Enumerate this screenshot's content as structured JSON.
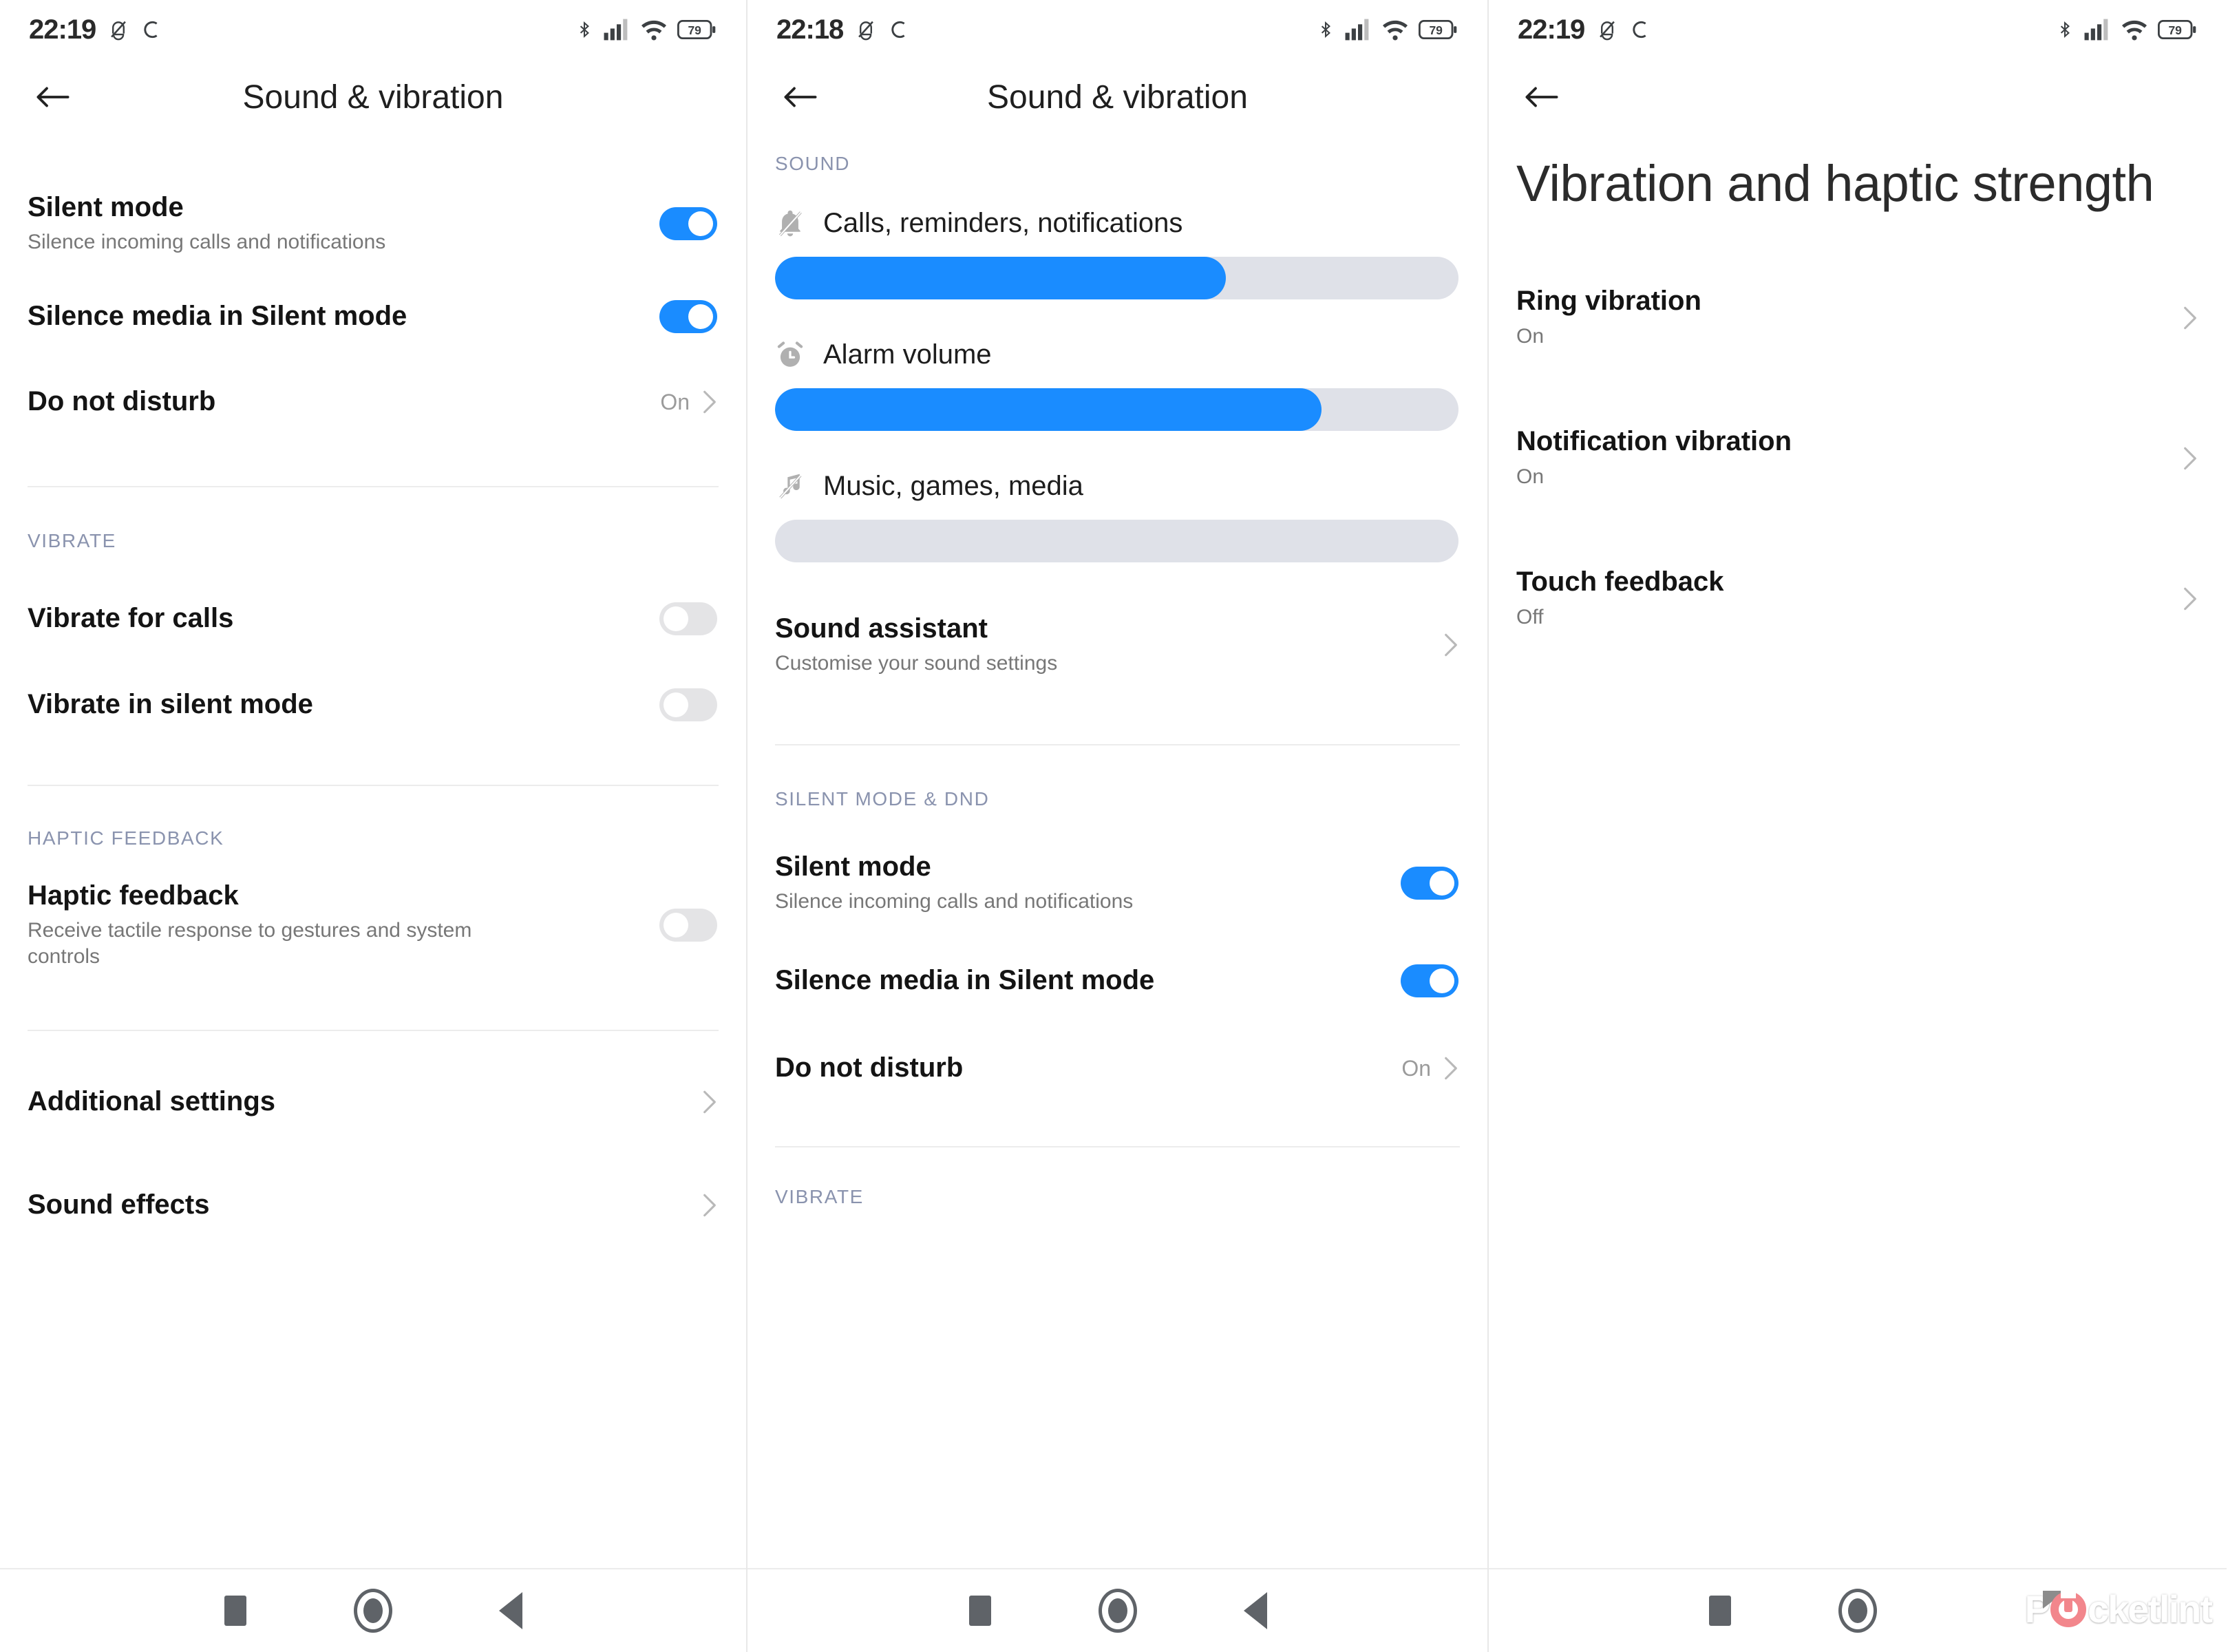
{
  "theme": {
    "accent": "#1a8cff",
    "toggle_off": "#e4e4e6",
    "section_header": "#8a93ae",
    "track": "#dfe1e8"
  },
  "panel1": {
    "status_bar": {
      "time": "22:19",
      "icons": [
        "bell-muted-icon",
        "sync-icon",
        "bluetooth-icon",
        "cellular-signal-icon",
        "wifi-icon",
        "battery-icon"
      ],
      "battery_level": "79"
    },
    "app_bar": {
      "title": "Sound & vibration",
      "back": "back-arrow-icon"
    },
    "items": [
      {
        "title": "Silent mode",
        "sub": "Silence incoming calls and notifications",
        "toggle": "on"
      },
      {
        "title": "Silence media in Silent mode",
        "sub": "",
        "toggle": "on"
      },
      {
        "title": "Do not disturb",
        "sub": "",
        "value": "On",
        "chevron": true
      }
    ],
    "vibrate_header": "VIBRATE",
    "vibrate_items": [
      {
        "title": "Vibrate for calls",
        "sub": "",
        "toggle": "off"
      },
      {
        "title": "Vibrate in silent mode",
        "sub": "",
        "toggle": "off"
      }
    ],
    "haptic_header": "HAPTIC FEEDBACK",
    "haptic_items": [
      {
        "title": "Haptic feedback",
        "sub": "Receive tactile response to gestures and system controls",
        "toggle": "off"
      }
    ],
    "extra_items": [
      {
        "title": "Additional settings",
        "chevron": true
      },
      {
        "title": "Sound effects",
        "chevron": true
      }
    ]
  },
  "panel2": {
    "status_bar": {
      "time": "22:18",
      "battery_level": "79"
    },
    "app_bar": {
      "title": "Sound & vibration",
      "back": "back-arrow-icon"
    },
    "sound_header": "SOUND",
    "sliders": [
      {
        "label": "Calls, reminders, notifications",
        "icon": "bell-muted-icon",
        "percent": 66
      },
      {
        "label": "Alarm volume",
        "icon": "alarm-clock-icon",
        "percent": 80
      },
      {
        "label": "Music, games, media",
        "icon": "music-note-muted-icon",
        "percent": 0
      }
    ],
    "sound_assistant": {
      "title": "Sound assistant",
      "sub": "Customise your sound settings",
      "chevron": true
    },
    "silent_header": "SILENT MODE & DND",
    "silent_items": [
      {
        "title": "Silent mode",
        "sub": "Silence incoming calls and notifications",
        "toggle": "on"
      },
      {
        "title": "Silence media in Silent mode",
        "sub": "",
        "toggle": "on"
      },
      {
        "title": "Do not disturb",
        "sub": "",
        "value": "On",
        "chevron": true
      }
    ],
    "vibrate_header": "VIBRATE"
  },
  "panel3": {
    "status_bar": {
      "time": "22:19",
      "battery_level": "79"
    },
    "app_bar": {
      "title": "",
      "back": "back-arrow-icon"
    },
    "big_title": "Vibration and haptic strength",
    "items": [
      {
        "title": "Ring vibration",
        "sub": "On",
        "chevron": true
      },
      {
        "title": "Notification vibration",
        "sub": "On",
        "chevron": true
      },
      {
        "title": "Touch feedback",
        "sub": "Off",
        "chevron": true
      }
    ]
  },
  "nav_bar": {
    "recents": "recents-square-icon",
    "home": "home-circle-icon",
    "back": "back-triangle-icon"
  },
  "watermark": {
    "text_before": "P",
    "text_after": "cketlint"
  }
}
